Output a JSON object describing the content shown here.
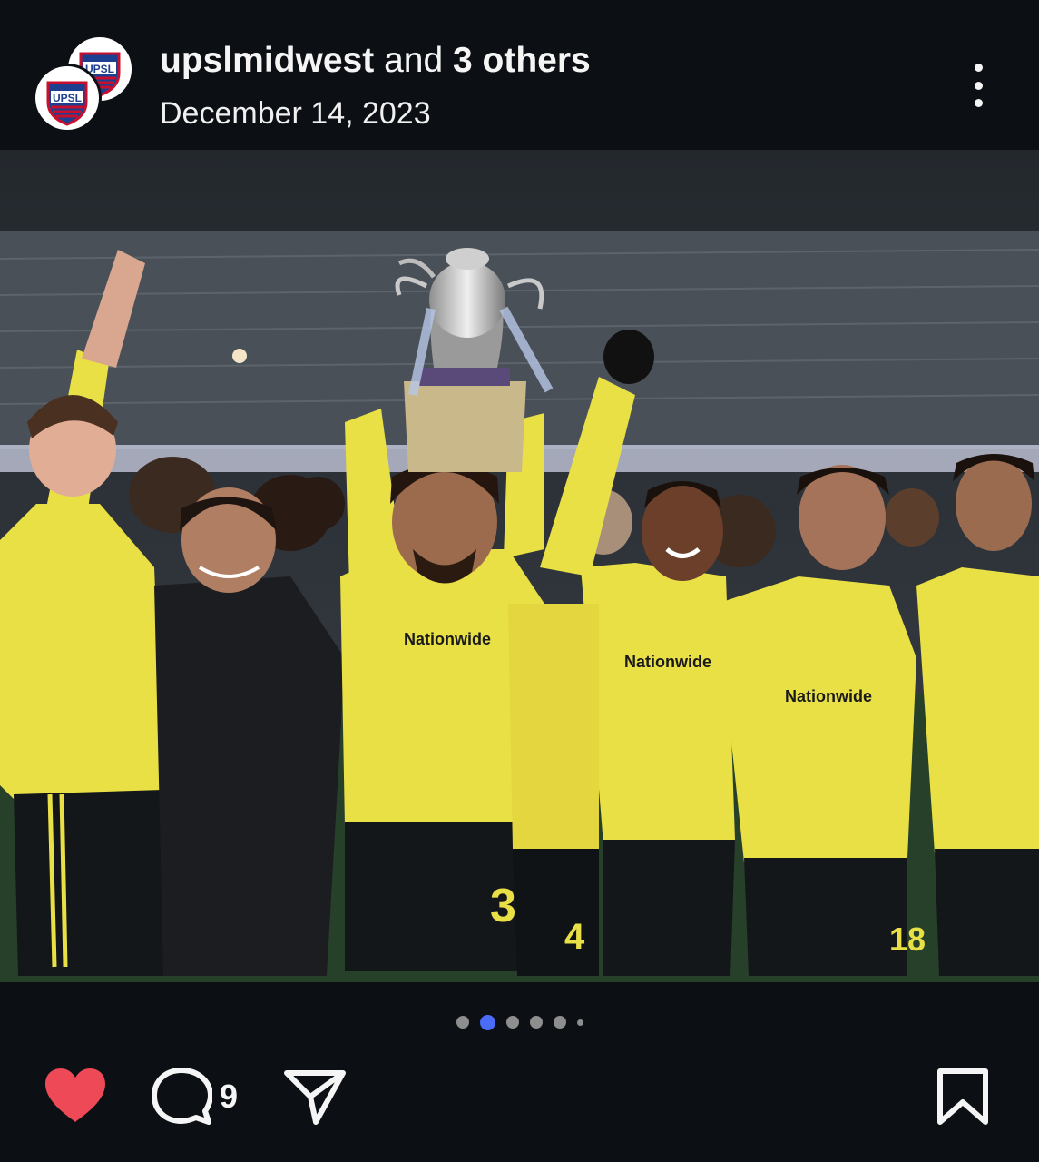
{
  "post": {
    "author": "upslmidwest",
    "collab_text": "and",
    "others": "3 others",
    "date": "December 14, 2023",
    "avatar_logo_text": "UPSL"
  },
  "photo": {
    "shirt_sponsor": "Nationwide",
    "jersey_numbers": [
      "3",
      "4",
      "18"
    ]
  },
  "carousel": {
    "total": 6,
    "active_index": 1
  },
  "actions": {
    "liked": true,
    "comment_count": "9"
  },
  "colors": {
    "background": "#0c1014",
    "like": "#ed4956",
    "carousel_active": "#4a6cf7",
    "carousel_inactive": "#8e8e8e",
    "jersey_yellow": "#e9e046"
  }
}
